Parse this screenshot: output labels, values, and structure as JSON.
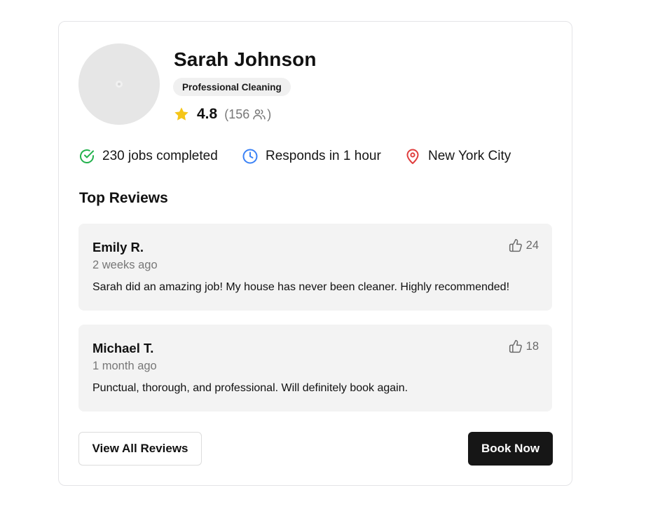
{
  "profile": {
    "name": "Sarah Johnson",
    "category": "Professional Cleaning",
    "rating": "4.8",
    "rating_count_open": "(156",
    "rating_count_close": ")"
  },
  "stats": [
    {
      "label": "230 jobs completed",
      "icon": "check-circle-icon",
      "color": "#22b14c"
    },
    {
      "label": "Responds in 1 hour",
      "icon": "clock-icon",
      "color": "#3b82f6"
    },
    {
      "label": "New York City",
      "icon": "map-pin-icon",
      "color": "#e03e3e"
    }
  ],
  "reviews_section": {
    "title": "Top Reviews",
    "items": [
      {
        "author": "Emily R.",
        "date": "2 weeks ago",
        "text": "Sarah did an amazing job! My house has never been cleaner. Highly recommended!",
        "likes": "24"
      },
      {
        "author": "Michael T.",
        "date": "1 month ago",
        "text": "Punctual, thorough, and professional. Will definitely book again.",
        "likes": "18"
      }
    ]
  },
  "actions": {
    "view_all_label": "View All Reviews",
    "book_label": "Book Now"
  },
  "colors": {
    "star": "#f5c518",
    "primary_button": "#161616",
    "review_bg": "#f3f3f3"
  }
}
